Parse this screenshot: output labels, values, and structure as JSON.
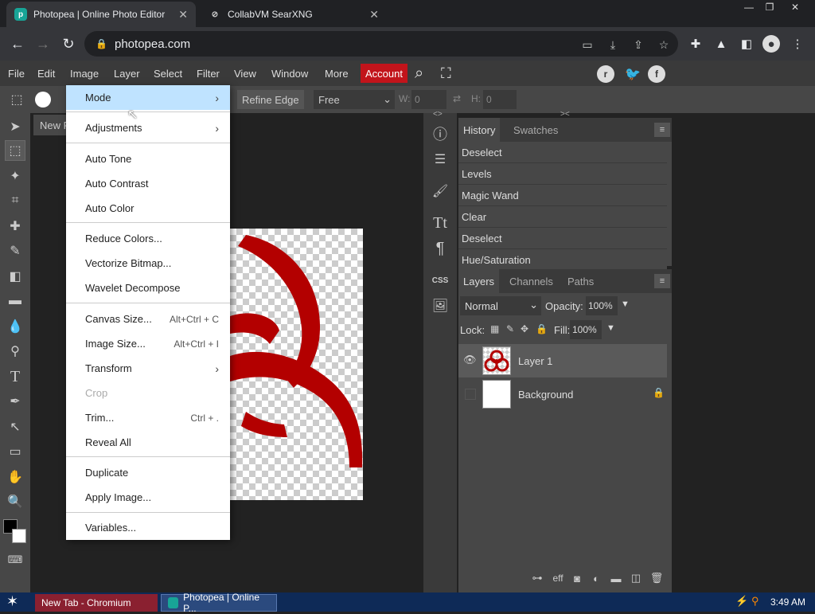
{
  "browser": {
    "tabs": [
      {
        "title": "Photopea | Online Photo Editor",
        "active": true,
        "icon": "photopea-icon"
      },
      {
        "title": "CollabVM SearXNG",
        "active": false,
        "icon": "searxng-icon"
      }
    ],
    "url": "photopea.com",
    "window_controls": [
      "minimize",
      "restore",
      "close"
    ]
  },
  "menubar": {
    "items": [
      "File",
      "Edit",
      "Image",
      "Layer",
      "Select",
      "Filter",
      "View",
      "Window",
      "More"
    ],
    "account_label": "Account",
    "colors": {
      "account_bg": "#c2141b"
    }
  },
  "options_bar": {
    "refine_edge": "Refine Edge",
    "style_value": "Free",
    "w_label": "W:",
    "w_value": "0",
    "h_label": "H:",
    "h_value": "0",
    "swap_symbol": "⇄"
  },
  "document_tab": {
    "label": "New P"
  },
  "image_menu": {
    "items": [
      {
        "label": "Mode",
        "submenu": true,
        "highlighted": true
      },
      {
        "label": "Adjustments",
        "submenu": true
      },
      {
        "label": "Auto Tone"
      },
      {
        "label": "Auto Contrast"
      },
      {
        "label": "Auto Color"
      },
      {
        "label": "Reduce Colors..."
      },
      {
        "label": "Vectorize Bitmap..."
      },
      {
        "label": "Wavelet Decompose"
      },
      {
        "label": "Canvas Size...",
        "shortcut": "Alt+Ctrl + C"
      },
      {
        "label": "Image Size...",
        "shortcut": "Alt+Ctrl + I"
      },
      {
        "label": "Transform",
        "submenu": true
      },
      {
        "label": "Crop",
        "disabled": true
      },
      {
        "label": "Trim...",
        "shortcut": "Ctrl + ."
      },
      {
        "label": "Reveal All"
      },
      {
        "label": "Duplicate"
      },
      {
        "label": "Apply Image..."
      },
      {
        "label": "Variables..."
      }
    ],
    "submenu_arrow": "›"
  },
  "history_panel": {
    "tabs": [
      "History",
      "Swatches"
    ],
    "entries": [
      "Deselect",
      "Levels",
      "Magic Wand",
      "Clear",
      "Deselect",
      "Hue/Saturation"
    ]
  },
  "layers_panel": {
    "tabs": [
      "Layers",
      "Channels",
      "Paths"
    ],
    "blend_mode": "Normal",
    "opacity_label": "Opacity:",
    "opacity_value": "100%",
    "lock_label": "Lock:",
    "fill_label": "Fill:",
    "fill_value": "100%",
    "layers": [
      {
        "name": "Layer 1",
        "visible": true,
        "selected": true
      },
      {
        "name": "Background",
        "visible": false,
        "locked": true
      }
    ],
    "footer_icons": [
      "link-icon",
      "effects-icon",
      "mask-icon",
      "adjustment-icon",
      "folder-icon",
      "new-layer-icon",
      "trash-icon"
    ],
    "effects_label": "eff"
  },
  "side_strip": {
    "css_label": "CSS"
  },
  "taskbar": {
    "tasks": [
      "New Tab - Chromium",
      "Photopea | Online P..."
    ],
    "time": "3:49 AM"
  },
  "colors": {
    "biohazard": "#b30000",
    "menu_highlight": "#bfe3ff"
  }
}
